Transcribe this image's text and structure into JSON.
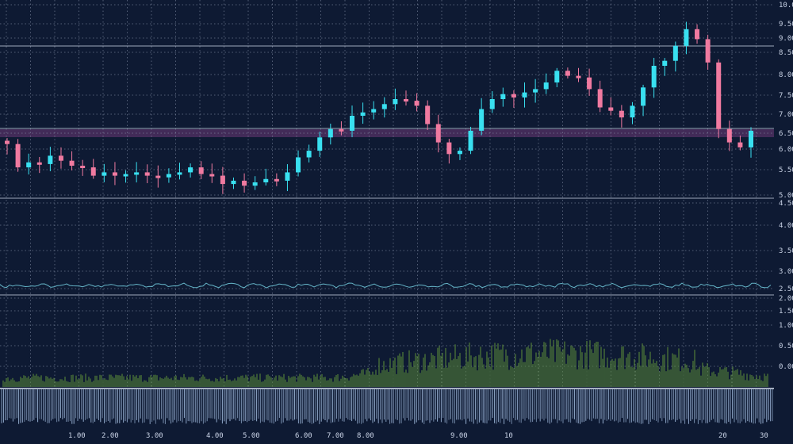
{
  "chart_data": {
    "type": "candlestick",
    "colors": {
      "background": "#0e1a33",
      "grid": "#8793aa",
      "up": "#39e0f0",
      "down": "#f07aa0",
      "volume": "#5d8f3a",
      "lower_bars": "#a9c3e6",
      "band": "#4b2f5f",
      "oscillator": "#6fc6d8"
    },
    "grid": true,
    "y_ticks": [
      "10.00",
      "9.50",
      "9.00",
      "8.50",
      "8.00",
      "7.50",
      "7.00",
      "6.50",
      "6.00",
      "5.50",
      "5.00",
      "4.50",
      "4.00",
      "3.50",
      "3.00",
      "2.50",
      "2.00",
      "1.50",
      "1.00",
      "0.50",
      "0.00"
    ],
    "x_ticks": [
      "1.00",
      "2.00",
      "3.00",
      "4.00",
      "5.00",
      "6.00",
      "7.00",
      "8.00",
      "9.00",
      "10",
      "20",
      "30",
      "10",
      "20"
    ],
    "price_series": [
      6.15,
      5.45,
      5.6,
      5.55,
      5.8,
      5.65,
      5.5,
      5.45,
      5.2,
      5.3,
      5.2,
      5.25,
      5.3,
      5.2,
      5.15,
      5.25,
      5.3,
      5.45,
      5.25,
      5.2,
      4.95,
      5.05,
      4.9,
      5.0,
      5.1,
      5.05,
      5.3,
      5.75,
      5.95,
      6.35,
      6.6,
      6.55,
      7.0,
      7.1,
      7.2,
      7.35,
      7.5,
      7.45,
      7.3,
      6.75,
      6.2,
      5.85,
      5.95,
      6.55,
      7.2,
      7.5,
      7.65,
      7.55,
      7.7,
      7.8,
      8.0,
      8.35,
      8.2,
      8.15,
      7.8,
      7.25,
      7.15,
      6.95,
      7.3,
      7.85,
      8.5,
      8.65,
      9.1,
      9.6,
      9.3,
      8.6,
      6.6,
      6.2,
      6.05,
      6.55
    ]
  }
}
